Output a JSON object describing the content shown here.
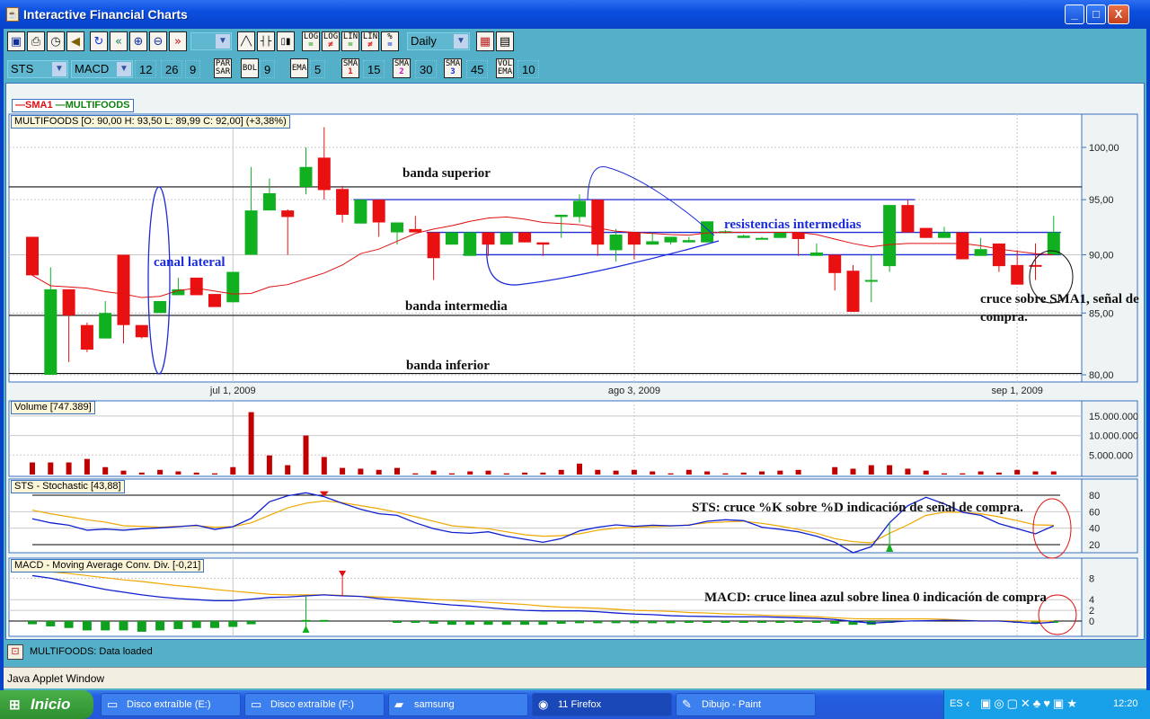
{
  "window": {
    "title": "Interactive Financial Charts",
    "minimize": "_",
    "maximize": "□",
    "close": "X"
  },
  "toolbar1": {
    "icons": [
      "window-icon",
      "print-icon",
      "timer-icon",
      "sound-icon",
      "refresh-icon",
      "rewind-icon",
      "zoom-in-icon",
      "zoom-out-icon",
      "forward-icon"
    ],
    "icon_glyphs": [
      "▣",
      "⎙",
      "◷",
      "◀",
      "↻",
      "«",
      "⊕",
      "⊖",
      "»"
    ],
    "range_select": "",
    "chart_types": [
      {
        "name": "line-chart-icon",
        "glyph": "╱╲"
      },
      {
        "name": "bar-chart-icon",
        "glyph": "┤├"
      },
      {
        "name": "candlestick-icon",
        "glyph": "▯▮"
      }
    ],
    "scale_buttons": [
      {
        "top": "LOG",
        "bottom": "=",
        "color": "#10a010"
      },
      {
        "top": "LOG",
        "bottom": "≠",
        "color": "#e01010"
      },
      {
        "top": "LIN",
        "bottom": "=",
        "color": "#10a010"
      },
      {
        "top": "LIN",
        "bottom": "≠",
        "color": "#e01010"
      },
      {
        "top": "%",
        "bottom": "=",
        "color": "#1030e0"
      }
    ],
    "period": "Daily",
    "color_icon": "▦",
    "settings_icon": "▤"
  },
  "toolbar2": {
    "indicator1": "STS",
    "indicator2": "MACD",
    "macd_params": [
      "12",
      "26",
      "9"
    ],
    "parsar": {
      "top": "PAR",
      "bottom": "SAR"
    },
    "bol": {
      "label": "BOL",
      "value": "9"
    },
    "ema": {
      "label": "EMA",
      "value": "5"
    },
    "sma1": {
      "top": "SMA",
      "bottom": "1",
      "color": "#e01010",
      "value": "15"
    },
    "sma2": {
      "top": "SMA",
      "bottom": "2",
      "color": "#c010c0",
      "value": "30"
    },
    "sma3": {
      "top": "SMA",
      "bottom": "3",
      "color": "#1030e0",
      "value": "45"
    },
    "volema": {
      "top": "VOL",
      "bottom": "EMA",
      "value": "10"
    }
  },
  "legend": {
    "sma1": "SMA1",
    "series": "MULTIFOODS",
    "sma1_color": "#e01010",
    "series_color": "#108010"
  },
  "price_info": "MULTIFOODS [O: 90,00  H: 93,50  L: 89,99  C: 92,00] (+3,38%)",
  "volume_info": "Volume [747.389]",
  "stoch_info": "STS - Stochastic [43,88]",
  "macd_info": "MACD - Moving Average Conv. Div. [-0,21]",
  "annotations": {
    "banda_superior": "banda superior",
    "canal_lateral": "canal lateral",
    "banda_intermedia": "banda intermedia",
    "banda_inferior": "banda inferior",
    "resistencias": "resistencias intermedias",
    "cruce_sma_1": "cruce sobre SMA1, señal de",
    "cruce_sma_2": "compra.",
    "sts_note": "STS: cruce %K sobre %D indicación de señal de compra.",
    "macd_note": "MACD: cruce linea azul sobre linea 0 indicación de compra"
  },
  "chart_data": {
    "type": "candlestick",
    "symbol": "MULTIFOODS",
    "x_ticks": [
      {
        "index": 11,
        "label": "jul 1, 2009"
      },
      {
        "index": 33,
        "label": "ago 3, 2009"
      },
      {
        "index": 54,
        "label": "sep 1, 2009"
      }
    ],
    "price": {
      "scale": "log",
      "ylim": [
        80,
        100
      ],
      "y_ticks": [
        {
          "v": 100,
          "label": "100,00"
        },
        {
          "v": 95,
          "label": "95,00"
        },
        {
          "v": 90,
          "label": "90,00"
        },
        {
          "v": 85,
          "label": "85,00"
        },
        {
          "v": 80,
          "label": "80,00"
        }
      ],
      "ohlc": [
        [
          91.6,
          91.6,
          88.2,
          88.2
        ],
        [
          80,
          88.9,
          80,
          87
        ],
        [
          87,
          87,
          81,
          84.8
        ],
        [
          84,
          84.2,
          81.8,
          82
        ],
        [
          82.9,
          86,
          82.9,
          85
        ],
        [
          90,
          90,
          82.5,
          84
        ],
        [
          84,
          84,
          82.9,
          83
        ],
        [
          85,
          86,
          85,
          86
        ],
        [
          86.5,
          88,
          86.5,
          87
        ],
        [
          88,
          88,
          86.5,
          86.5
        ],
        [
          86.6,
          86.6,
          85.5,
          85.5
        ],
        [
          85.9,
          88.5,
          85.9,
          88.5
        ],
        [
          90,
          98.1,
          90,
          94
        ],
        [
          94,
          97,
          94,
          95.6
        ],
        [
          94,
          94.1,
          90,
          93.4
        ],
        [
          96.2,
          100,
          95.5,
          98.1
        ],
        [
          99,
          102,
          95,
          95.9
        ],
        [
          96,
          96.3,
          92.9,
          93.6
        ],
        [
          92.8,
          95,
          92.8,
          95
        ],
        [
          95,
          95,
          91.6,
          92.9
        ],
        [
          92,
          92.9,
          90.9,
          92.9
        ],
        [
          92.3,
          93.5,
          92,
          92
        ],
        [
          92,
          92,
          87.8,
          89.7
        ],
        [
          90.9,
          92,
          90.9,
          92
        ],
        [
          89.9,
          92,
          89.9,
          92
        ],
        [
          92,
          92,
          89.9,
          90.9
        ],
        [
          90.9,
          92,
          90.9,
          92
        ],
        [
          92,
          92,
          91.1,
          91.1
        ],
        [
          91.1,
          91.1,
          89.9,
          90.9
        ],
        [
          93.4,
          93.6,
          91.5,
          93.6
        ],
        [
          93.4,
          95.5,
          92.9,
          94.9
        ],
        [
          95,
          95,
          89.9,
          90.9
        ],
        [
          90.4,
          92.3,
          89.4,
          91.8
        ],
        [
          92,
          92,
          89.6,
          90.9
        ],
        [
          90.9,
          92,
          90.9,
          91.2
        ],
        [
          91.1,
          91.6,
          90.9,
          91.6
        ],
        [
          91.1,
          91.6,
          91.1,
          91.3
        ],
        [
          91.1,
          93,
          91.1,
          93
        ],
        [
          92,
          92.2,
          91.9,
          92.1
        ],
        [
          91.5,
          91.8,
          91.5,
          91.7
        ],
        [
          91.4,
          91.6,
          91.4,
          91.5
        ],
        [
          91.5,
          92,
          91.5,
          92
        ],
        [
          92,
          92,
          89.9,
          91.4
        ],
        [
          89.9,
          91,
          89.9,
          90.2
        ],
        [
          90,
          90,
          86.9,
          88.4
        ],
        [
          88.6,
          89.1,
          85.1,
          85.1
        ],
        [
          87.8,
          90,
          85.9,
          87.8
        ],
        [
          89,
          94.5,
          88.5,
          94.5
        ],
        [
          94.5,
          95,
          92,
          92
        ],
        [
          92.4,
          92.4,
          91.5,
          91.5
        ],
        [
          91.5,
          92.5,
          91.5,
          92
        ],
        [
          92,
          92,
          89.6,
          89.6
        ],
        [
          89.9,
          91.5,
          89.9,
          90.5
        ],
        [
          91,
          91,
          88.5,
          89
        ],
        [
          89.1,
          90.4,
          87.4,
          87.4
        ],
        [
          89.1,
          91,
          87.8,
          89.05
        ],
        [
          90,
          93.5,
          89.99,
          92
        ]
      ],
      "sma1": [
        88.2,
        87.3,
        87.2,
        87.1,
        86.8,
        86.6,
        86.3,
        86.4,
        86.9,
        87.1,
        86.85,
        86.6,
        86.65,
        87.2,
        87.4,
        87.9,
        88.4,
        89.1,
        90.1,
        90.5,
        91.2,
        91.9,
        92.3,
        92.6,
        93.0,
        93.3,
        93.4,
        93.2,
        92.9,
        92.8,
        92.7,
        92.4,
        92.1,
        92.0,
        91.9,
        91.8,
        91.75,
        91.95,
        92.0,
        92.0,
        92.0,
        92.0,
        92.0,
        91.8,
        91.4,
        91.0,
        90.7,
        90.9,
        91.0,
        91.0,
        91.0,
        91.0,
        90.8,
        90.5,
        90.3,
        90.1,
        90.0
      ],
      "bands": [
        {
          "name": "banda superior",
          "value": 96.2
        },
        {
          "name": "banda intermedia",
          "value": 84.8
        },
        {
          "name": "banda inferior",
          "value": 80.1
        }
      ],
      "resistances": [
        {
          "value": 95,
          "from": 18,
          "to": 48
        },
        {
          "value": 92,
          "from": 22,
          "to": 57
        },
        {
          "value": 90,
          "from": 24,
          "to": 57
        }
      ],
      "up_color": "#10b020",
      "down_color": "#e81010"
    },
    "volume": {
      "unit": "millions",
      "y_ticks": [
        {
          "v": 15,
          "label": "15.000.000"
        },
        {
          "v": 10,
          "label": "10.000.000"
        },
        {
          "v": 5,
          "label": "5.000.000"
        }
      ],
      "values": [
        3.1,
        3.1,
        3.1,
        4.0,
        1.9,
        1.0,
        0.5,
        1.2,
        0.8,
        0.5,
        0.3,
        1.9,
        16.0,
        4.9,
        2.4,
        10.0,
        4.5,
        1.7,
        1.5,
        1.2,
        1.7,
        0.3,
        1.0,
        0.3,
        0.8,
        1.0,
        0.3,
        0.5,
        0.5,
        1.2,
        2.8,
        1.2,
        1.0,
        1.2,
        0.8,
        0.3,
        1.2,
        0.8,
        0.3,
        0.5,
        0.8,
        1.0,
        1.2,
        0,
        1.9,
        1.5,
        2.4,
        2.4,
        1.5,
        1.0,
        0.3,
        0.3,
        0.8,
        0.5,
        1.2,
        0.8,
        0.8
      ]
    },
    "stochastic": {
      "y_ticks": [
        {
          "v": 80,
          "label": "80"
        },
        {
          "v": 60,
          "label": "60"
        },
        {
          "v": 40,
          "label": "40"
        },
        {
          "v": 20,
          "label": "20"
        }
      ],
      "k": [
        51.3,
        46.5,
        43.6,
        37.5,
        38.9,
        37.5,
        39.3,
        40.4,
        41.8,
        43.6,
        38.5,
        41.8,
        52.0,
        72.0,
        79.3,
        82.9,
        78.2,
        70.2,
        62.9,
        57.5,
        55.6,
        46.5,
        39.3,
        34.9,
        33.8,
        35.6,
        30.2,
        26.5,
        22.9,
        27.3,
        36.7,
        41.1,
        44.0,
        42.2,
        43.6,
        42.9,
        43.6,
        48.4,
        50.2,
        49.1,
        41.1,
        38.5,
        35.6,
        30.2,
        22.9,
        10.2,
        17.5,
        46.5,
        67.3,
        77.5,
        69.5,
        59.3,
        55.6,
        45.5,
        39.3,
        33.1,
        42.9
      ],
      "d": [
        61.8,
        57.5,
        53.8,
        50.2,
        47.3,
        42.9,
        42.2,
        41.1,
        42.2,
        42.9,
        41.1,
        41.8,
        46.5,
        55.6,
        64.7,
        70.2,
        73.1,
        70.9,
        67.3,
        63.6,
        59.3,
        53.8,
        48.4,
        42.9,
        41.1,
        39.3,
        35.6,
        32.0,
        30.2,
        30.9,
        33.1,
        37.5,
        40.0,
        41.1,
        41.8,
        42.5,
        44.0,
        46.5,
        47.6,
        48.4,
        45.8,
        42.5,
        38.5,
        33.8,
        27.3,
        23.6,
        22.2,
        33.8,
        44.0,
        55.6,
        59.3,
        59.3,
        57.5,
        53.8,
        49.1,
        44.0,
        43.6
      ],
      "sell_signal_index": 16,
      "buy_signal_index": 47
    },
    "macd": {
      "y_ticks": [
        {
          "v": 8,
          "label": "8"
        },
        {
          "v": 4,
          "label": "4"
        },
        {
          "v": 2,
          "label": "2"
        },
        {
          "v": 0,
          "label": "0"
        }
      ],
      "macd": [
        8.5,
        8.0,
        7.3,
        6.6,
        5.9,
        5.4,
        4.9,
        4.5,
        4.2,
        4.0,
        3.8,
        3.8,
        4.1,
        4.4,
        4.5,
        4.7,
        4.9,
        4.7,
        4.6,
        4.2,
        3.9,
        3.6,
        3.3,
        3.0,
        2.8,
        2.5,
        2.2,
        2.0,
        1.9,
        1.9,
        1.9,
        1.75,
        1.5,
        1.3,
        1.2,
        1.0,
        0.9,
        0.85,
        0.8,
        0.8,
        0.8,
        0.7,
        0.6,
        0.5,
        0.3,
        -0.05,
        -0.4,
        -0.2,
        0,
        0.05,
        0.15,
        0.1,
        0,
        0,
        -0.2,
        -0.45,
        -0.2
      ],
      "signal": [
        9.4,
        9.2,
        8.9,
        8.5,
        8.1,
        7.7,
        7.4,
        7.0,
        6.6,
        6.3,
        5.9,
        5.6,
        5.3,
        5.0,
        4.9,
        4.9,
        4.9,
        4.8,
        4.6,
        4.5,
        4.4,
        4.2,
        4.0,
        3.9,
        3.7,
        3.5,
        3.3,
        3.1,
        2.8,
        2.6,
        2.5,
        2.4,
        2.2,
        2.0,
        1.9,
        1.8,
        1.6,
        1.5,
        1.35,
        1.25,
        1.1,
        1.0,
        0.95,
        0.8,
        0.6,
        0.45,
        0.4,
        0.4,
        0.4,
        0.4,
        0.35,
        0.15,
        0.05,
        0.05,
        0,
        0,
        0
      ],
      "histogram": [
        -0.6,
        -1.0,
        -1.3,
        -1.75,
        -1.75,
        -1.75,
        -2.0,
        -1.75,
        -1.5,
        -1.3,
        -1.3,
        -1.1,
        -0.6,
        0,
        0,
        0.2,
        0.2,
        0,
        0,
        0,
        -0.1,
        -0.3,
        -0.5,
        -0.7,
        -0.7,
        -0.7,
        -0.7,
        -0.7,
        -0.7,
        -0.5,
        -0.4,
        -0.4,
        -0.4,
        -0.4,
        -0.4,
        -0.4,
        -0.3,
        -0.2,
        -0.2,
        -0.2,
        -0.2,
        -0.2,
        -0.2,
        -0.3,
        -0.5,
        -0.7,
        -0.7,
        -0.3,
        0,
        0,
        0,
        0,
        0,
        0,
        -0.2,
        -0.3,
        -0.2
      ],
      "buy_signal_index": 15,
      "sell_signal_index": 17
    }
  },
  "status": {
    "message": "MULTIFOODS: Data loaded"
  },
  "applet_bar": "Java Applet Window",
  "taskbar": {
    "start": "Inicio",
    "tasks": [
      {
        "label": "Disco extraíble (E:)",
        "icon": "drive-icon",
        "glyph": "▭"
      },
      {
        "label": "Disco extraíble (F:)",
        "icon": "drive-icon",
        "glyph": "▭"
      },
      {
        "label": "samsung",
        "icon": "folder-icon",
        "glyph": "▰"
      },
      {
        "label": "11 Firefox",
        "icon": "firefox-icon",
        "glyph": "◉"
      },
      {
        "label": "Dibujo - Paint",
        "icon": "paint-icon",
        "glyph": "✎"
      }
    ],
    "lang": "ES",
    "clock": "12:20"
  }
}
